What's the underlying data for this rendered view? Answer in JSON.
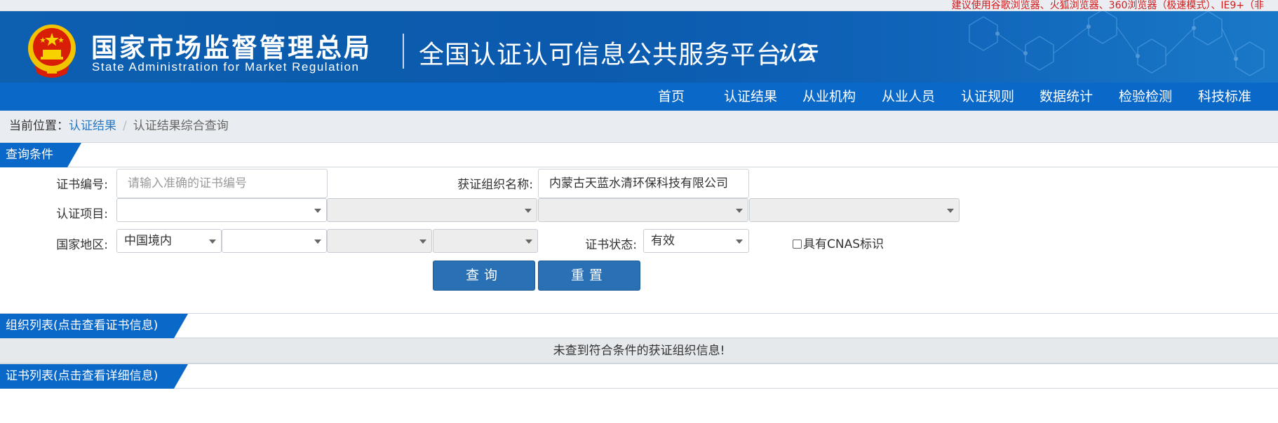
{
  "browser_tip": "建议使用谷歌浏览器、火狐浏览器、360浏览器（极速模式）、IE9+（非",
  "header": {
    "agency_cn": "国家市场监督管理总局",
    "agency_en": "State Administration  for  Market Regulation",
    "platform": "全国认证认可信息公共服务平台",
    "logo_text": "认云",
    "brand_color": "#0b5aad"
  },
  "nav": {
    "items": [
      "首页",
      "认证结果",
      "从业机构",
      "从业人员",
      "认证规则",
      "数据统计",
      "检验检测",
      "科技标准"
    ],
    "background": "#0a68c9"
  },
  "breadcrumb": {
    "prefix": "当前位置：",
    "link": "认证结果",
    "separator": "/",
    "current": "认证结果综合查询"
  },
  "query": {
    "section_title": "查询条件",
    "cert_no": {
      "label": "证书编号:",
      "placeholder": "请输入准确的证书编号",
      "value": ""
    },
    "org_name": {
      "label": "获证组织名称:",
      "value": "内蒙古天蓝水清环保科技有限公司"
    },
    "project": {
      "label": "认证项目:",
      "selects": [
        "",
        "",
        "",
        ""
      ]
    },
    "region": {
      "label": "国家地区:",
      "selects": [
        "中国境内",
        "",
        "",
        ""
      ]
    },
    "status": {
      "label": "证书状态:",
      "value": "有效"
    },
    "cnas": {
      "label": "具有CNAS标识",
      "checked": false
    },
    "search_button": "查询",
    "reset_button": "重置"
  },
  "org_list": {
    "section_title": "组织列表(点击查看证书信息)",
    "empty_message": "未查到符合条件的获证组织信息!"
  },
  "cert_list": {
    "section_title": "证书列表(点击查看详细信息)"
  }
}
